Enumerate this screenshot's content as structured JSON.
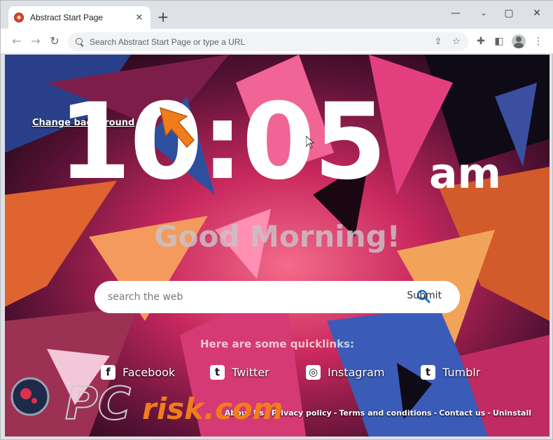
{
  "browser": {
    "tab_title": "Abstract Start Page",
    "tab_close": "✕",
    "new_tab": "+",
    "minimize": "—",
    "maximize": "▢",
    "close": "✕",
    "omnibox_placeholder": "Search Abstract Start Page or type a URL",
    "back": "←",
    "forward": "→",
    "reload": "↻"
  },
  "page": {
    "change_background": "Change background",
    "time": "10:05",
    "ampm": "am",
    "greeting": "Good Morning!",
    "search_placeholder": "search the web",
    "submit": "Submit",
    "quicklinks_heading": "Here are some quicklinks:",
    "quicklinks": [
      {
        "label": "Facebook",
        "icon": "f"
      },
      {
        "label": "Twitter",
        "icon": "t"
      },
      {
        "label": "Instagram",
        "icon": "◎"
      },
      {
        "label": "Tumblr",
        "icon": "t"
      }
    ],
    "footer": [
      "About Us",
      "Privacy policy",
      "Terms and conditions",
      "Contact us",
      "Uninstall"
    ],
    "footer_sep": "-"
  },
  "watermark": {
    "text_pc": "PC",
    "text_risk": "risk.com"
  },
  "colors": {
    "accent_orange": "#f07d1b",
    "search_icon_blue": "#1e6fc8"
  }
}
